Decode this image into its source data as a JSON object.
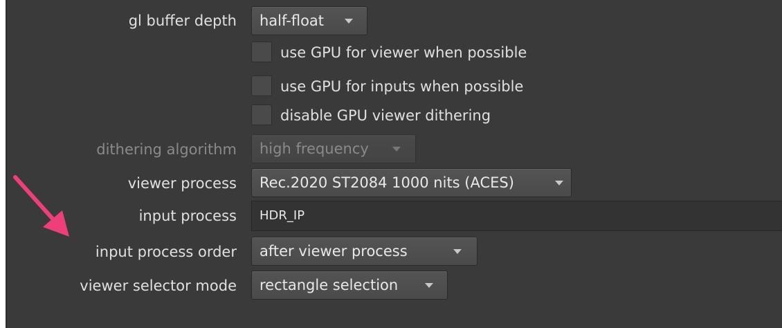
{
  "settings": {
    "gl_buffer_depth": {
      "label": "gl buffer depth",
      "value": "half-float"
    },
    "use_gpu_viewer": {
      "label": "use GPU for viewer when possible",
      "checked": false
    },
    "use_gpu_inputs": {
      "label": "use GPU for inputs when possible",
      "checked": false
    },
    "disable_dithering": {
      "label": "disable GPU viewer dithering",
      "checked": false
    },
    "dithering_algorithm": {
      "label": "dithering algorithm",
      "value": "high frequency",
      "disabled": true
    },
    "viewer_process": {
      "label": "viewer process",
      "value": "Rec.2020 ST2084 1000 nits (ACES)"
    },
    "input_process": {
      "label": "input process",
      "value": "HDR_IP"
    },
    "input_process_order": {
      "label": "input process order",
      "value": "after viewer process"
    },
    "viewer_selector_mode": {
      "label": "viewer selector mode",
      "value": "rectangle selection"
    }
  },
  "colors": {
    "panel_bg": "#3a3a3a",
    "text": "#e0e0e0",
    "disabled_text": "#8a8a8a",
    "annotation_arrow": "#ee3f7a"
  },
  "icons": {
    "dropdown_arrow": "chevron-down-icon",
    "annotation": "annotation-arrow-icon"
  }
}
